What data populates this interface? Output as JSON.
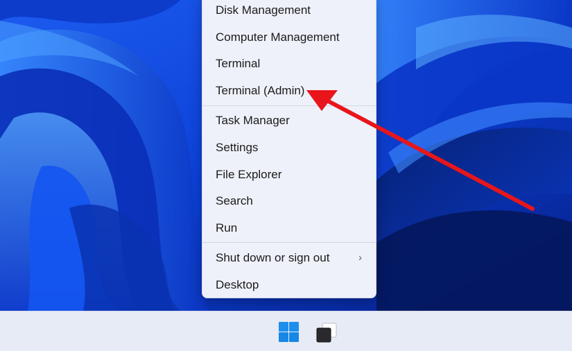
{
  "context_menu": {
    "items": [
      {
        "label": "Disk Management"
      },
      {
        "label": "Computer Management"
      },
      {
        "label": "Terminal"
      },
      {
        "label": "Terminal (Admin)"
      },
      {
        "label": "Task Manager"
      },
      {
        "label": "Settings"
      },
      {
        "label": "File Explorer"
      },
      {
        "label": "Search"
      },
      {
        "label": "Run"
      },
      {
        "label": "Shut down or sign out",
        "submenu_icon": "chevron-right-icon",
        "submenu_glyph": "›"
      },
      {
        "label": "Desktop"
      }
    ]
  },
  "taskbar": {
    "start_icon": "windows-logo-icon",
    "taskview_icon": "task-view-icon"
  },
  "annotation": {
    "arrow_color": "#e8161b",
    "points_to": "Terminal (Admin)"
  },
  "colors": {
    "wallpaper_base": "#0a2ea6",
    "menu_background": "#eef1f9",
    "taskbar_background": "#e7ebf5",
    "windows_logo": "#1a8ae6"
  }
}
